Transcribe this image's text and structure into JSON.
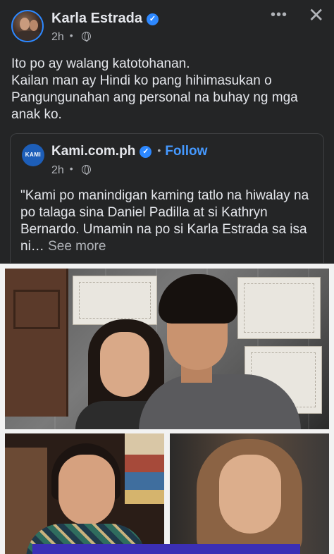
{
  "post": {
    "author": "Karla Estrada",
    "time": "2h",
    "lines": [
      "Ito po ay walang katotohanan.",
      "Kailan man ay Hindi ko pang hihimasukan o",
      "Pangungunahan ang personal na buhay ng mga",
      "anak ko."
    ]
  },
  "header": {
    "more_glyph": "•••",
    "close_glyph": "✕"
  },
  "shared_post": {
    "logo_text": "KAMI",
    "page_name": "Kami.com.ph",
    "separator": "•",
    "follow_label": "Follow",
    "time": "2h",
    "text": "\"Kami po manindigan kaming tatlo na hiwalay na po talaga sina Daniel Padilla at si Kathryn Bernardo. Umamin na po si Karla Estrada sa isa ni…",
    "see_more_label": "See more"
  },
  "icons": {
    "verified": "verified-badge-icon",
    "privacy": "globe-icon",
    "more": "more-options-icon",
    "close": "close-icon"
  },
  "colors": {
    "background": "#242526",
    "primary_text": "#e4e6eb",
    "secondary_text": "#b0b3b8",
    "accent": "#2d88ff",
    "follow": "#4599ff"
  }
}
